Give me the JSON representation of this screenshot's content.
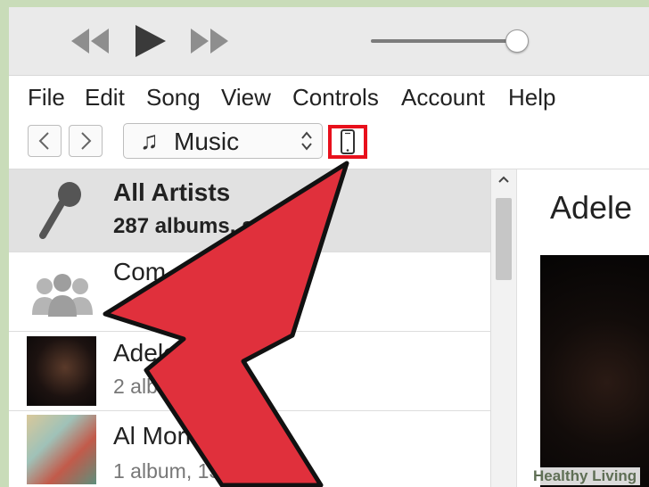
{
  "menu": [
    "File",
    "Edit",
    "Song",
    "View",
    "Controls",
    "Account",
    "Help"
  ],
  "media": {
    "label": "Music",
    "note_icon": "♫"
  },
  "artists": [
    {
      "title": "All Artists",
      "sub": "287 albums, songs"
    },
    {
      "title": "Com",
      "sub": ""
    },
    {
      "title": "Adele",
      "sub": "2 alb 29 s"
    },
    {
      "title": "Al Morissette",
      "sub": "1 album, 13 songs"
    }
  ],
  "detail": {
    "title": "Adele"
  },
  "watermark": "Healthy Living",
  "volume_level": 0.93,
  "colors": {
    "highlight": "#e8101c",
    "arrow": "#e0303c",
    "selected_row": "#e1e1e1"
  },
  "icons": [
    "rewind-icon",
    "play-icon",
    "fast-forward-icon",
    "back-arrow-icon",
    "forward-arrow-icon",
    "music-note-icon",
    "up-down-chevron-icon",
    "iphone-device-icon",
    "microphone-icon",
    "people-icon",
    "scroll-up-icon",
    "red-pointer-arrow"
  ]
}
